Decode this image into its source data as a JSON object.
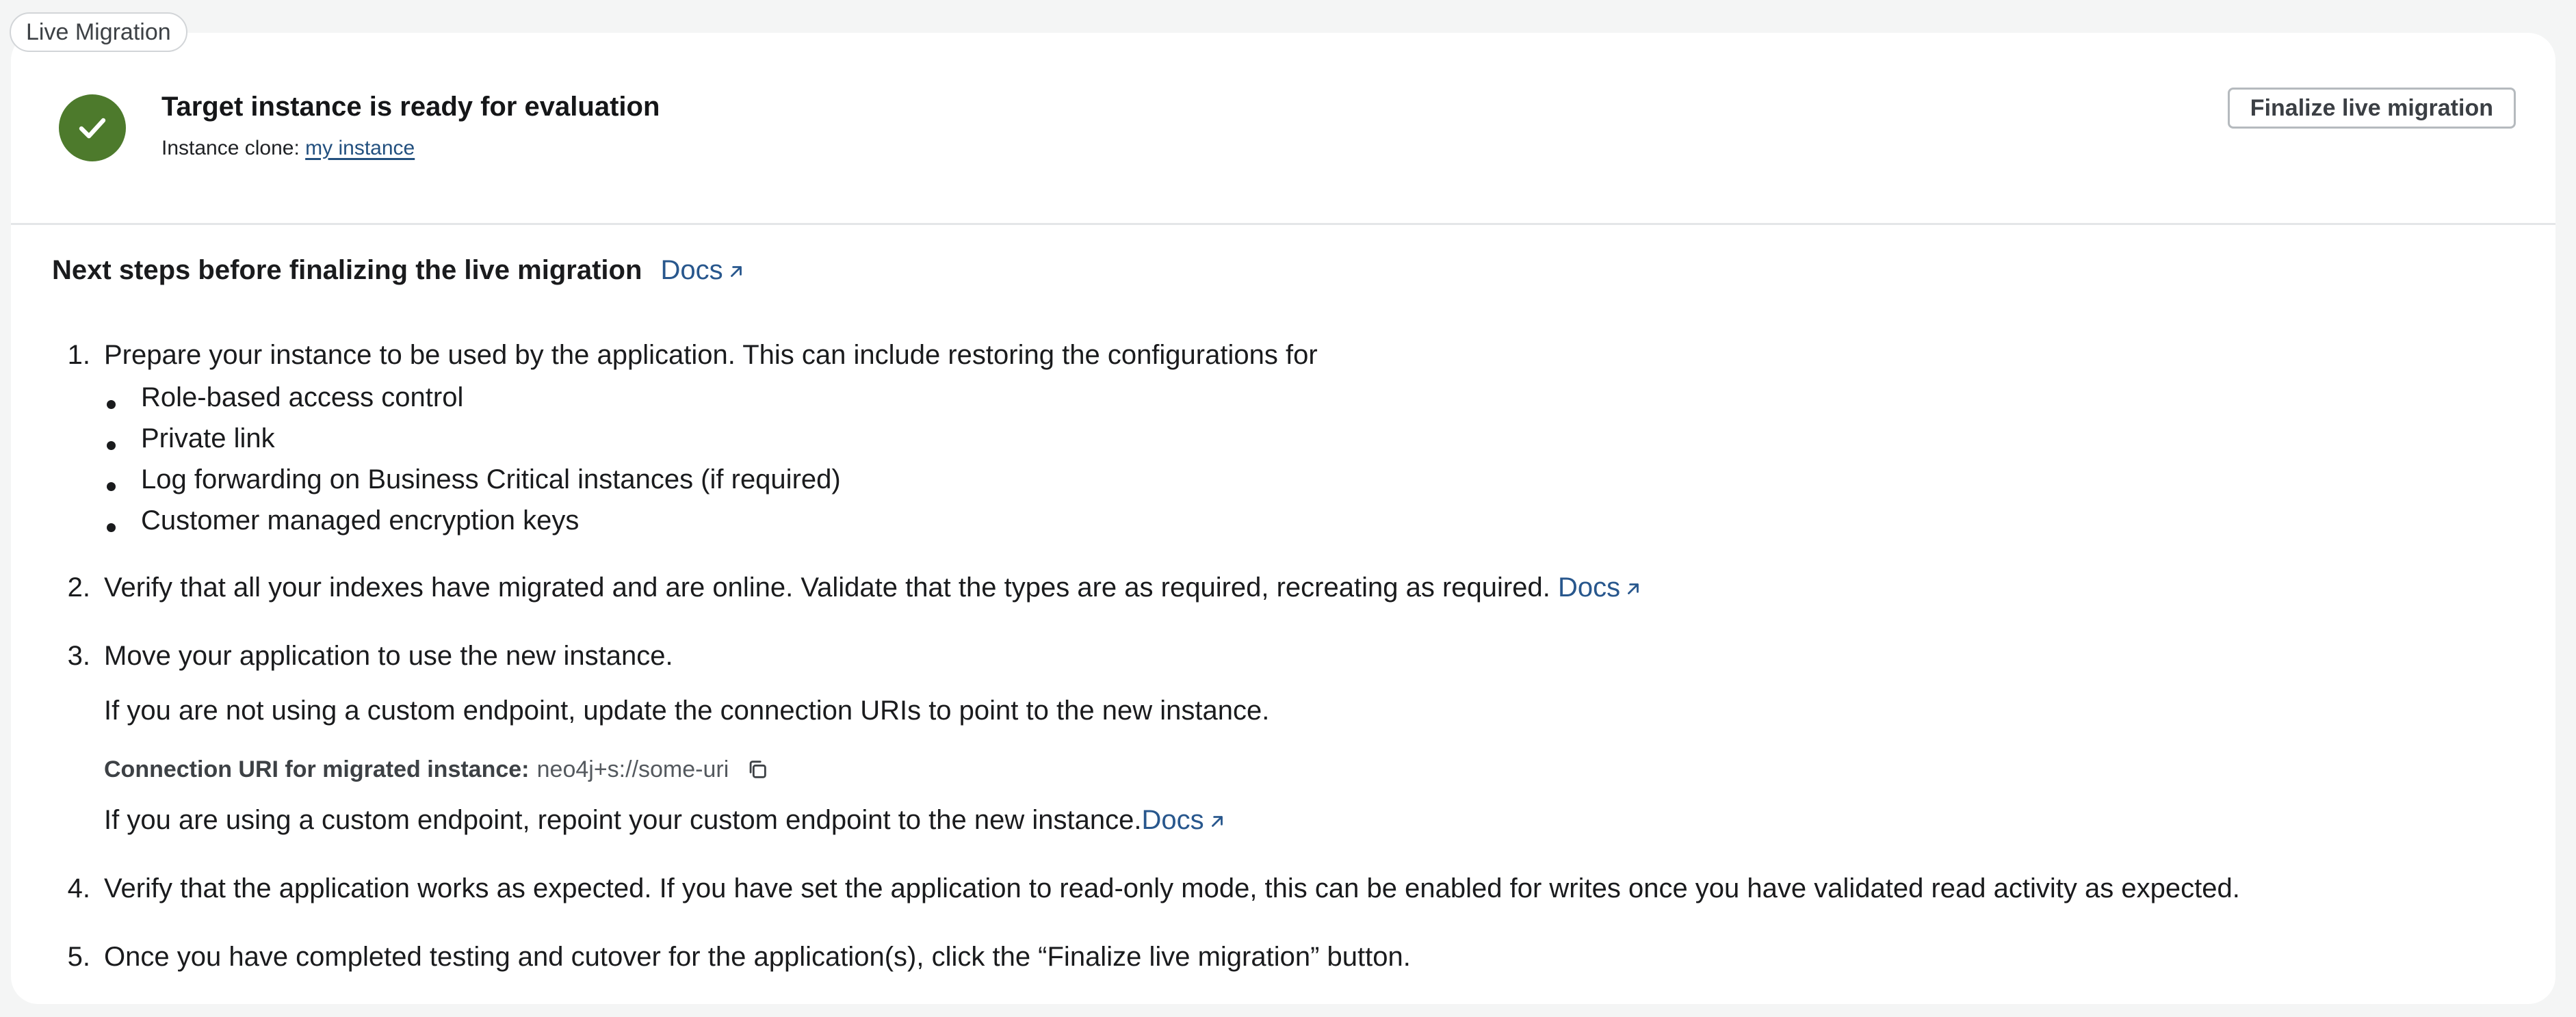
{
  "tag": {
    "label": "Live Migration"
  },
  "header": {
    "title": "Target instance is ready for evaluation",
    "clone_label": "Instance clone:",
    "clone_link": "my instance",
    "finalize_button": "Finalize live migration"
  },
  "next_steps": {
    "title": "Next steps before finalizing the live migration",
    "docs": "Docs",
    "steps": [
      {
        "num": "1.",
        "text": "Prepare your instance to be used by the application. This can include restoring the configurations for"
      },
      {
        "num": "2.",
        "text": "Verify that all your indexes have migrated and are online. Validate that the types are as required, recreating as required.",
        "docs": "Docs"
      },
      {
        "num": "3.",
        "text": "Move your application to use the new instance."
      },
      {
        "num": "4.",
        "text": "Verify that the application works as expected. If you have set the application to read-only mode, this can be enabled for writes once you have validated read activity as expected."
      },
      {
        "num": "5.",
        "text": "Once you have completed testing and cutover for the application(s), click the “Finalize live migration” button."
      }
    ],
    "bullets": [
      "Role-based access control",
      "Private link",
      "Log forwarding on Business Critical instances (if required)",
      "Customer managed encryption keys"
    ],
    "step3": {
      "no_endpoint": "If you are not using a custom endpoint, update the connection URIs to point to the new instance.",
      "uri_label": "Connection URI for migrated instance:",
      "uri_value": "neo4j+s://some-uri",
      "custom_endpoint": "If you are using a custom endpoint, repoint your custom endpoint to the new instance.",
      "docs": "Docs"
    }
  },
  "colors": {
    "success": "#4d7a2c",
    "link": "#28578d"
  },
  "icons": [
    "check-icon",
    "external-link-icon",
    "copy-icon"
  ]
}
